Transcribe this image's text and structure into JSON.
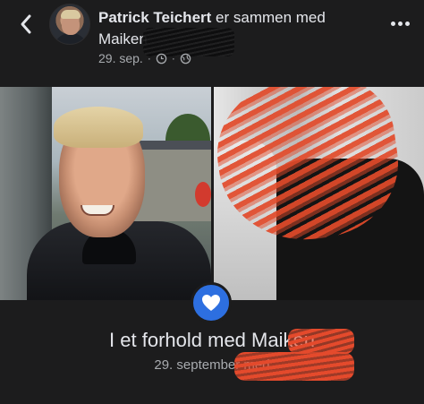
{
  "header": {
    "author_name": "Patrick Teichert",
    "action_text": " er sammen med",
    "tagged_name": "Maiken",
    "date": "29. sep.",
    "meta_separator": "·",
    "back_icon": "chevron-left-icon",
    "more_icon": "more-horizontal-icon",
    "clock_icon": "clock-icon",
    "privacy_icon": "globe-icon"
  },
  "life_event": {
    "title": "I et forhold med Maiken",
    "subtitle": "29. september med",
    "badge_icon": "heart-icon",
    "badge_color": "#2d6fe0"
  },
  "colors": {
    "background": "#1c1c1d",
    "redaction": "#e44a2c"
  }
}
